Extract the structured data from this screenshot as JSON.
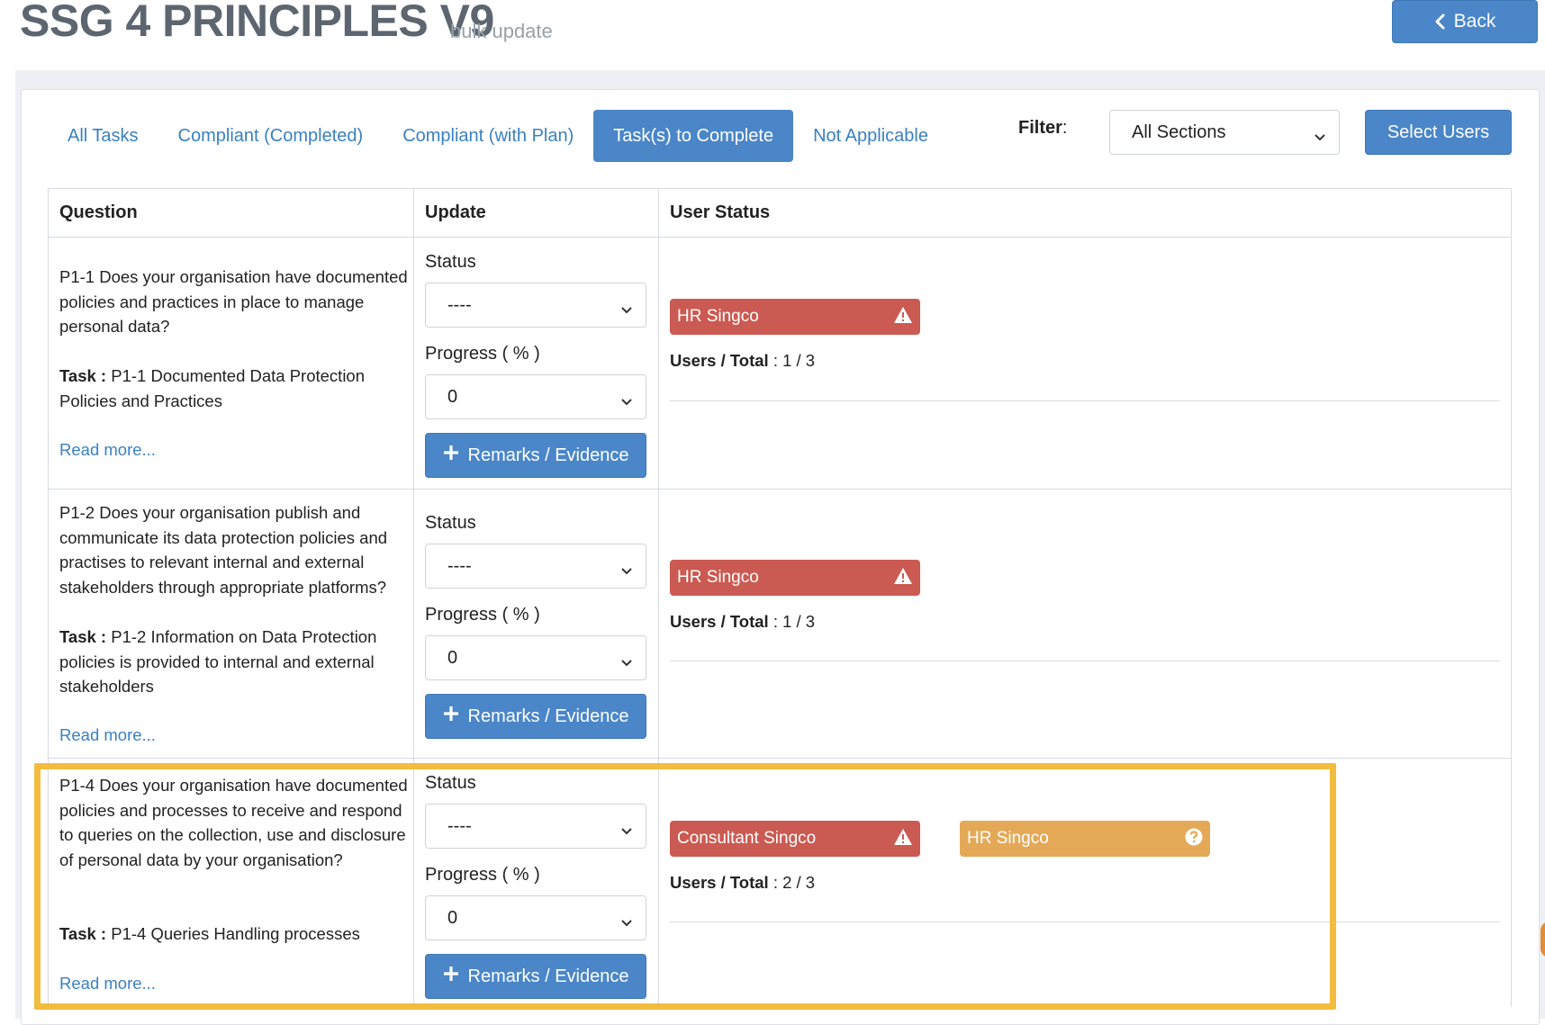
{
  "header": {
    "title": "SSG 4 PRINCIPLES V9",
    "subtitle": "bulk update",
    "back_label": "Back"
  },
  "tabs": [
    {
      "label": "All Tasks",
      "active": false
    },
    {
      "label": "Compliant (Completed)",
      "active": false
    },
    {
      "label": "Compliant (with Plan)",
      "active": false
    },
    {
      "label": "Task(s) to Complete",
      "active": true
    },
    {
      "label": "Not Applicable",
      "active": false
    }
  ],
  "filter": {
    "label": "Filter",
    "label_suffix": ":",
    "selected": "All Sections",
    "select_users_label": "Select Users"
  },
  "table": {
    "columns": [
      "Question",
      "Update",
      "User Status"
    ],
    "labels": {
      "status": "Status",
      "progress": "Progress ( % )",
      "remarks": "Remarks / Evidence",
      "task_prefix": "Task :",
      "read_more": "Read more...",
      "users_total": "Users / Total"
    },
    "rows": [
      {
        "question": "P1-1 Does your organisation have documented policies and practices in place to manage personal data?",
        "task": "P1-1 Documented Data Protection Policies and Practices",
        "status_value": "----",
        "progress_value": "0",
        "users": [
          {
            "name": "HR Singco",
            "color": "#cb5a52",
            "icon": "warning-icon"
          }
        ],
        "users_total": ": 1 / 3"
      },
      {
        "question": "P1-2 Does your organisation publish and communicate its data protection policies and practises to relevant internal and external stakeholders through appropriate platforms?",
        "task": "P1-2 Information on Data Protection policies is provided to internal and external stakeholders",
        "status_value": "----",
        "progress_value": "0",
        "users": [
          {
            "name": "HR Singco",
            "color": "#cb5a52",
            "icon": "warning-icon"
          }
        ],
        "users_total": ": 1 / 3"
      },
      {
        "question": "P1-4 Does your organisation have documented policies and processes to receive and respond to queries on the collection, use and disclosure of personal data by your organisation?",
        "task": "P1-4 Queries Handling processes",
        "status_value": "----",
        "progress_value": "0",
        "users": [
          {
            "name": "Consultant Singco",
            "color": "#cb5a52",
            "icon": "warning-icon"
          },
          {
            "name": "HR Singco",
            "color": "#e4a957",
            "icon": "question-circle-icon"
          }
        ],
        "users_total": ": 2 / 3"
      }
    ]
  },
  "colors": {
    "primary": "#4a86c8",
    "link": "#3a80c2",
    "danger": "#cb5a52",
    "warning": "#e4a957",
    "highlight": "#f2bc3f"
  }
}
